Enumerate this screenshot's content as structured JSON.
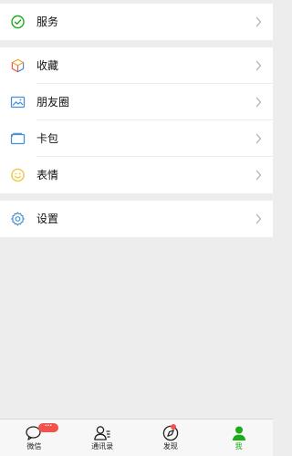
{
  "menu": {
    "groups": [
      {
        "items": [
          {
            "label": "服务",
            "icon": "service-check-icon"
          }
        ]
      },
      {
        "items": [
          {
            "label": "收藏",
            "icon": "favorites-cube-icon"
          },
          {
            "label": "朋友圈",
            "icon": "moments-photo-icon"
          },
          {
            "label": "卡包",
            "icon": "card-wallet-icon"
          },
          {
            "label": "表情",
            "icon": "sticker-smile-icon"
          }
        ]
      },
      {
        "items": [
          {
            "label": "设置",
            "icon": "settings-gear-icon"
          }
        ]
      }
    ]
  },
  "tabbar": {
    "tabs": [
      {
        "label": "微信",
        "icon": "chat-bubble-icon"
      },
      {
        "label": "通讯录",
        "icon": "contacts-icon"
      },
      {
        "label": "发现",
        "icon": "compass-icon"
      },
      {
        "label": "我",
        "icon": "me-person-icon"
      }
    ],
    "active_tab": "我",
    "badge_text": "···"
  },
  "colors": {
    "background": "#ededed",
    "accent_green": "#1aad19",
    "badge_red": "#f2524b",
    "icon_blue": "#4a8fd6",
    "icon_yellow": "#f3c543"
  }
}
